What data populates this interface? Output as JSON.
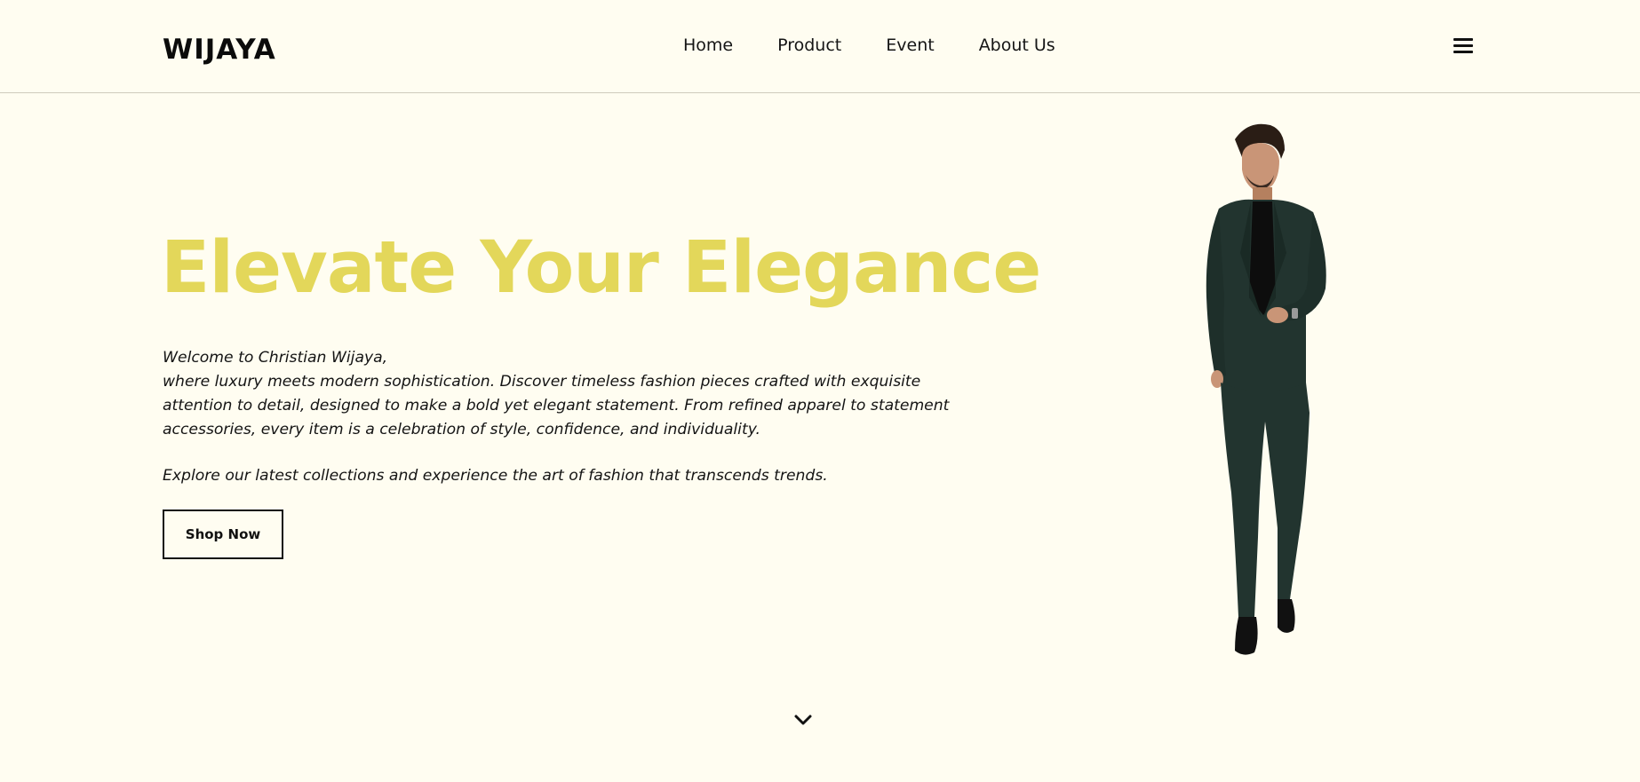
{
  "header": {
    "logo": "WIJAYA",
    "nav": [
      {
        "label": "Home"
      },
      {
        "label": "Product"
      },
      {
        "label": "Event"
      },
      {
        "label": "About Us"
      }
    ],
    "menu_icon": "hamburger-menu-icon"
  },
  "hero": {
    "title": "Elevate Your Elegance",
    "intro_line1": "Welcome to Christian Wijaya,",
    "intro_line2": "where luxury meets modern sophistication. Discover timeless fashion pieces crafted with exquisite attention to detail, designed to make a bold yet elegant statement. From refined apparel to statement accessories, every item is a celebration of style, confidence, and individuality.",
    "intro_line3": "Explore our latest collections and experience the art of fashion that transcends trends.",
    "cta_label": "Shop Now",
    "scroll_icon": "chevron-down-icon"
  },
  "colors": {
    "background": "#fffdf1",
    "accent": "#e3d75a",
    "text": "#111111",
    "suit": "#22342f"
  }
}
